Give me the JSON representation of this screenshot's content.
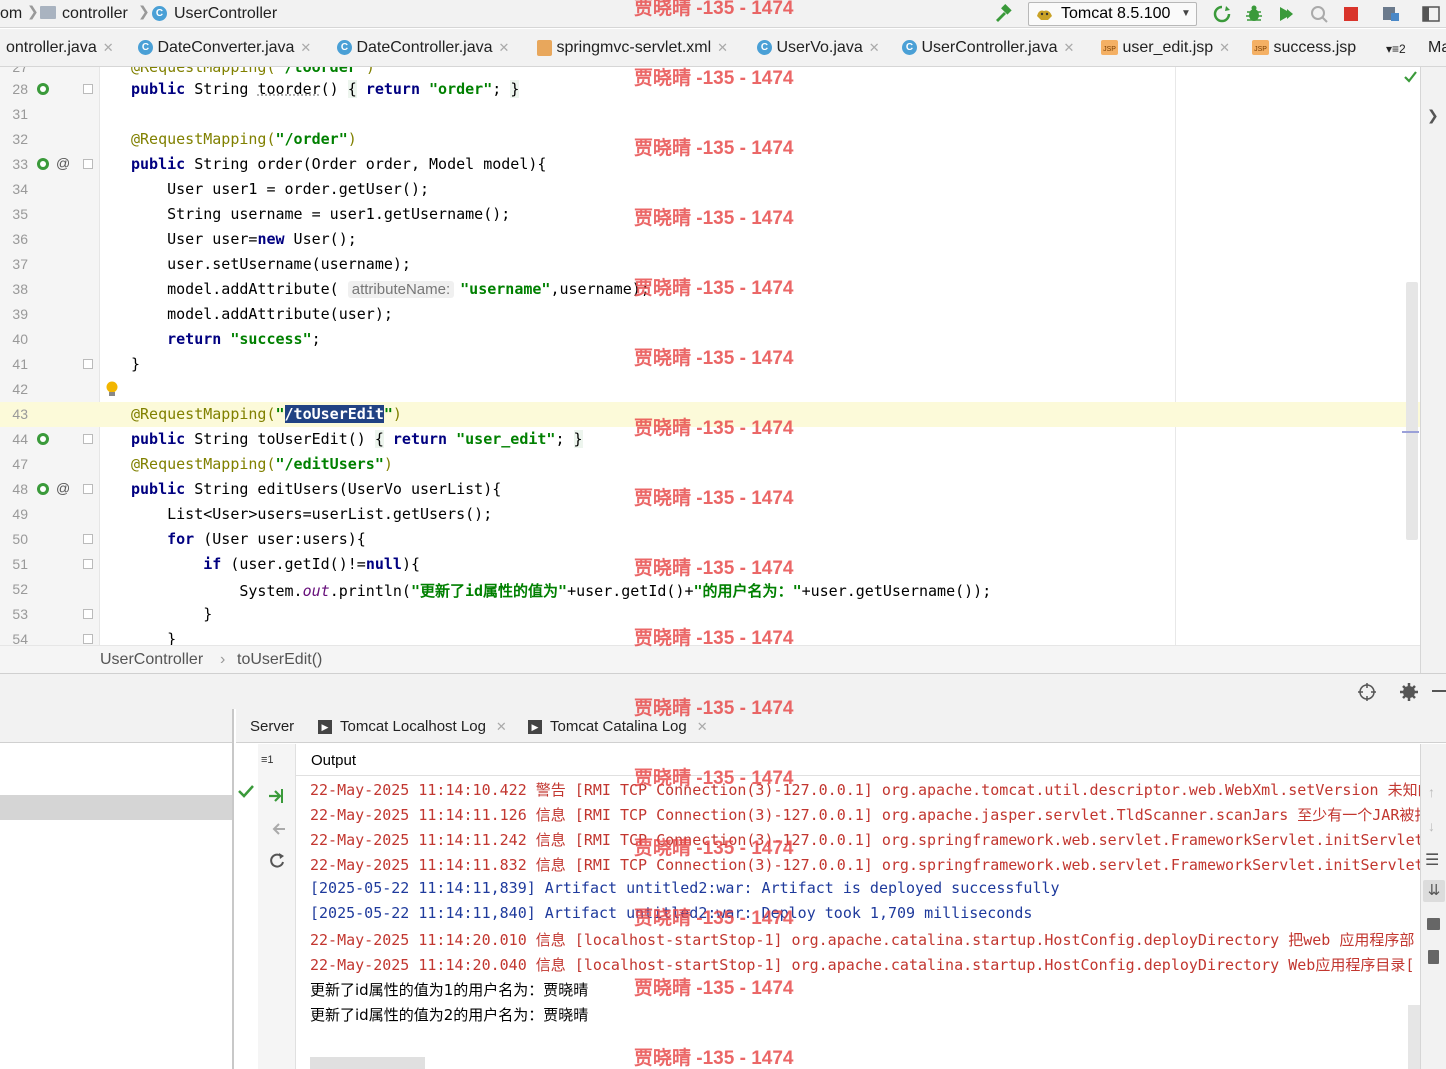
{
  "navbar": {
    "crumb_root": "om",
    "crumb_package": "controller",
    "crumb_class": "UserController",
    "class_icon_letter": "C",
    "run_config": "Tomcat 8.5.100"
  },
  "tabs": [
    {
      "label": "ontroller.java",
      "type": "java"
    },
    {
      "label": "DateConverter.java",
      "type": "java"
    },
    {
      "label": "DateController.java",
      "type": "java"
    },
    {
      "label": "springmvc-servlet.xml",
      "type": "xml"
    },
    {
      "label": "UserVo.java",
      "type": "java"
    },
    {
      "label": "UserController.java",
      "type": "java",
      "active": true
    },
    {
      "label": "user_edit.jsp",
      "type": "jsp"
    },
    {
      "label": "success.jsp",
      "type": "jsp"
    }
  ],
  "tabs_overflow": "≡2",
  "tabs_cut": "Ma",
  "editor": {
    "lines": [
      {
        "n": "27",
        "code": "    @RequestMapping(\"/toorder\")"
      },
      {
        "n": "28",
        "code": "    public String toorder() { return \"order\"; }"
      },
      {
        "n": "31",
        "code": ""
      },
      {
        "n": "32",
        "code": "    @RequestMapping(\"/order\")"
      },
      {
        "n": "33",
        "code": "    public String order(Order order, Model model){"
      },
      {
        "n": "34",
        "code": "        User user1 = order.getUser();"
      },
      {
        "n": "35",
        "code": "        String username = user1.getUsername();"
      },
      {
        "n": "36",
        "code": "        User user=new User();"
      },
      {
        "n": "37",
        "code": "        user.setUsername(username);"
      },
      {
        "n": "38",
        "code": "        model.addAttribute( attributeName: \"username\",username);"
      },
      {
        "n": "39",
        "code": "        model.addAttribute(user);"
      },
      {
        "n": "40",
        "code": "        return \"success\";"
      },
      {
        "n": "41",
        "code": "    }"
      },
      {
        "n": "42",
        "code": ""
      },
      {
        "n": "43",
        "code": "    @RequestMapping(\"/toUserEdit\")"
      },
      {
        "n": "44",
        "code": "    public String toUserEdit() { return \"user_edit\"; }"
      },
      {
        "n": "47",
        "code": "    @RequestMapping(\"/editUsers\")"
      },
      {
        "n": "48",
        "code": "    public String editUsers(UserVo userList){"
      },
      {
        "n": "49",
        "code": "        List<User>users=userList.getUsers();"
      },
      {
        "n": "50",
        "code": "        for (User user:users){"
      },
      {
        "n": "51",
        "code": "            if (user.getId()!=null){"
      },
      {
        "n": "52",
        "code": "                System.out.println(\"更新了id属性的值为\"+user.getId()+\"的用户名为：\"+user.getUsername());"
      },
      {
        "n": "53",
        "code": "            }"
      },
      {
        "n": "54",
        "code": "        }"
      }
    ],
    "hint_attribute_name": "attributeName:",
    "breadcrumb_class": "UserController",
    "breadcrumb_method": "toUserEdit()"
  },
  "bottom": {
    "subtabs": [
      "Server",
      "Tomcat Localhost Log",
      "Tomcat Catalina Log"
    ],
    "output_label": "Output",
    "console": [
      {
        "text": "22-May-2025 11:14:10.422 警告 [RMI TCP Connection(3)-127.0.0.1] org.apache.tomcat.util.descriptor.web.WebXml.setVersion 未知的",
        "style": "red"
      },
      {
        "text": "22-May-2025 11:14:11.126 信息 [RMI TCP Connection(3)-127.0.0.1] org.apache.jasper.servlet.TldScanner.scanJars 至少有一个JAR被扫",
        "style": "red"
      },
      {
        "text": "22-May-2025 11:14:11.242 信息 [RMI TCP Connection(3)-127.0.0.1] org.springframework.web.servlet.FrameworkServlet.initServlet",
        "style": "red"
      },
      {
        "text": "22-May-2025 11:14:11.832 信息 [RMI TCP Connection(3)-127.0.0.1] org.springframework.web.servlet.FrameworkServlet.initServlet",
        "style": "red"
      },
      {
        "text": "[2025-05-22 11:14:11,839] Artifact untitled2:war: Artifact is deployed successfully",
        "style": "blue"
      },
      {
        "text": "[2025-05-22 11:14:11,840] Artifact untitled2:war: Deploy took 1,709 milliseconds",
        "style": "blue"
      },
      {
        "text": "22-May-2025 11:14:20.010 信息 [localhost-startStop-1] org.apache.catalina.startup.HostConfig.deployDirectory 把web 应用程序部",
        "style": "red"
      },
      {
        "text": "22-May-2025 11:14:20.040 信息 [localhost-startStop-1] org.apache.catalina.startup.HostConfig.deployDirectory Web应用程序目录[",
        "style": "red"
      },
      {
        "text": "更新了id属性的值为1的用户名为：贾晓晴",
        "style": "black"
      },
      {
        "text": "更新了id属性的值为2的用户名为：贾晓晴",
        "style": "black"
      }
    ],
    "thread_count": "≡1"
  },
  "watermark": "贾晓晴 -135 - 1474",
  "colors": {
    "keyword": "#000080",
    "string": "#008000",
    "annotation": "#808000",
    "selection": "#214283",
    "log_red": "#c2362f",
    "log_blue": "#1e3a9c"
  }
}
